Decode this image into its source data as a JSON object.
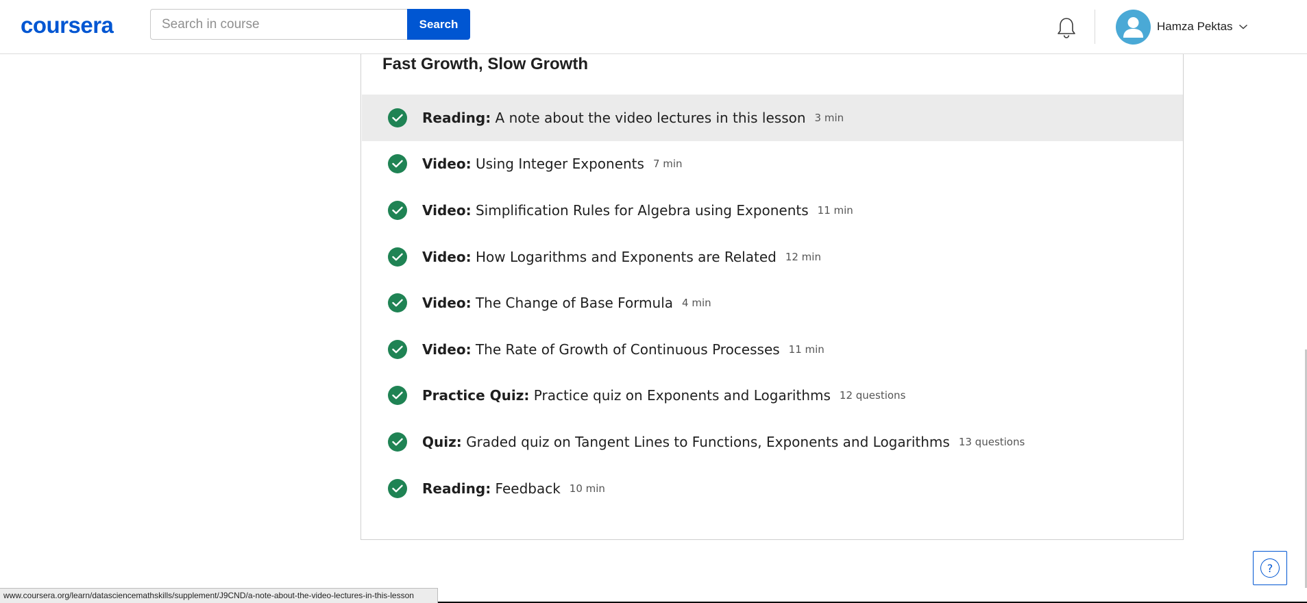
{
  "header": {
    "logo_text": "coursera",
    "search": {
      "placeholder": "Search in course",
      "value": "",
      "button_label": "Search"
    },
    "user": {
      "name": "Hamza Pektas"
    }
  },
  "lesson": {
    "title": "Fast Growth, Slow Growth",
    "items": [
      {
        "type": "Reading:",
        "title": "A note about the video lectures in this lesson",
        "meta": "3 min",
        "completed": true,
        "active": true
      },
      {
        "type": "Video:",
        "title": "Using Integer Exponents",
        "meta": "7 min",
        "completed": true,
        "active": false
      },
      {
        "type": "Video:",
        "title": "Simplification Rules for Algebra using Exponents",
        "meta": "11 min",
        "completed": true,
        "active": false
      },
      {
        "type": "Video:",
        "title": "How Logarithms and Exponents are Related",
        "meta": "12 min",
        "completed": true,
        "active": false
      },
      {
        "type": "Video:",
        "title": "The Change of Base Formula",
        "meta": "4 min",
        "completed": true,
        "active": false
      },
      {
        "type": "Video:",
        "title": "The Rate of Growth of Continuous Processes",
        "meta": "11 min",
        "completed": true,
        "active": false
      },
      {
        "type": "Practice Quiz:",
        "title": "Practice quiz on Exponents and Logarithms",
        "meta": "12 questions",
        "completed": true,
        "active": false
      },
      {
        "type": "Quiz:",
        "title": "Graded quiz on Tangent Lines to Functions, Exponents and Logarithms",
        "meta": "13 questions",
        "completed": true,
        "active": false
      },
      {
        "type": "Reading:",
        "title": "Feedback",
        "meta": "10 min",
        "completed": true,
        "active": false
      }
    ]
  },
  "status_bar": {
    "url": "www.coursera.org/learn/datasciencemathskills/supplement/J9CND/a-note-about-the-video-lectures-in-this-lesson"
  },
  "help": {
    "symbol": "?"
  },
  "colors": {
    "brand": "#0056d2",
    "check": "#1f8354",
    "avatar": "#4aa9d6",
    "active_row": "#ebebeb"
  },
  "icons": {
    "bell": "bell-icon",
    "avatar": "user-avatar-icon",
    "chevron": "chevron-down-icon",
    "check": "check-circle-icon",
    "help": "help-icon"
  }
}
